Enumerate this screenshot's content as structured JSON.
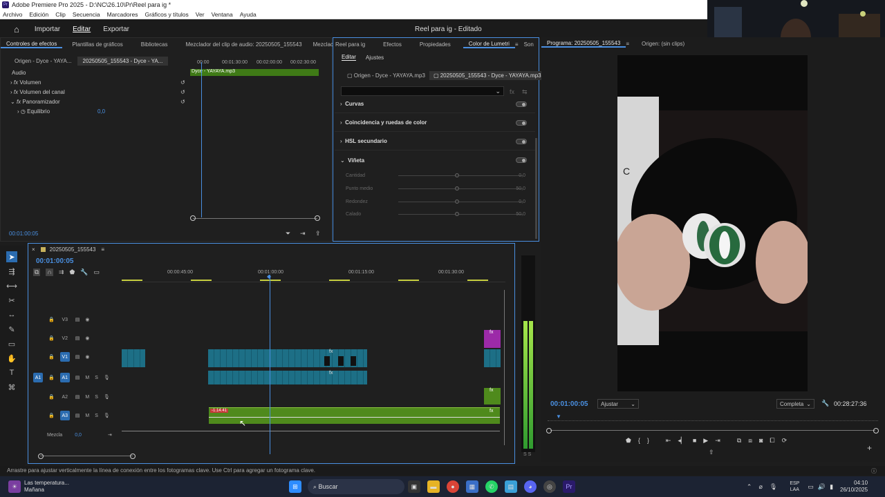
{
  "window": {
    "title": "Adobe Premiere Pro 2025 - D:\\NC\\26.10\\Pr\\Reel para ig *"
  },
  "menu": [
    "Archivo",
    "Edición",
    "Clip",
    "Secuencia",
    "Marcadores",
    "Gráficos y títulos",
    "Ver",
    "Ventana",
    "Ayuda"
  ],
  "nav": {
    "home_icon": "home-icon",
    "importar": "Importar",
    "editar": "Editar",
    "exportar": "Exportar",
    "project_title": "Reel para ig - Editado"
  },
  "effect_controls": {
    "tabs": [
      "Controles de efectos",
      "Plantillas de gráficos",
      "Bibliotecas",
      "Mezclador del clip de audio: 20250505_155543",
      "Mezclac"
    ],
    "source_tabs": [
      "Origen - Dyce - YAYA...",
      "20250505_155543 - Dyce - YA..."
    ],
    "section": "Audio",
    "rows": [
      "Volumen",
      "Volumen del canal",
      "Panoramizador",
      "Equilibrio"
    ],
    "equilibrio_value": "0,0",
    "ruler": [
      "00:00",
      "00:01:30:00",
      "00:02:00:00",
      "00:02:30:00"
    ],
    "clip_name": "Dyce - YAYAYA.mp3",
    "timecode": "00:01:00:05"
  },
  "lumetri": {
    "tabs": [
      "Reel para ig",
      "Efectos",
      "Propiedades",
      "Color de Lumetri",
      "Son"
    ],
    "subtabs": [
      "Editar",
      "Ajustes"
    ],
    "source_tabs": [
      "Origen - Dyce - YAYAYA.mp3",
      "20250505_155543 - Dyce - YAYAYA.mp3"
    ],
    "sections": [
      "Curvas",
      "Coincidencia y ruedas de color",
      "HSL secundario",
      "Viñeta"
    ],
    "vignette": [
      {
        "label": "Cantidad",
        "value": "0,0"
      },
      {
        "label": "Punto medio",
        "value": "50,0"
      },
      {
        "label": "Redondez",
        "value": "0,0"
      },
      {
        "label": "Calado",
        "value": "50,0"
      }
    ]
  },
  "program": {
    "tabs": [
      "Programa: 20250505_155543",
      "Origen: (sin clips)"
    ],
    "timecode": "00:01:00:05",
    "fit": "Ajustar",
    "quality": "Completa",
    "duration": "00:28:27:36",
    "preview_text": "C"
  },
  "timeline": {
    "sequence_name": "20250505_155543",
    "timecode": "00:01:00:05",
    "ruler": [
      "00:00:45:00",
      "00:01:00:00",
      "00:01:15:00",
      "00:01:30:00"
    ],
    "video_tracks": [
      "V3",
      "V2",
      "V1"
    ],
    "audio_tracks": [
      "A1",
      "A2",
      "A3"
    ],
    "mix_label": "Mezcla",
    "mix_value": "0,0",
    "clip_label": "-1.14.41",
    "fx": "fx",
    "audio_meter_label": "S S"
  },
  "status_bar": "Arrastre para ajustar verticalmente la línea de conexión entre los fotogramas clave. Use Ctrl para agregar un fotograma clave.",
  "taskbar": {
    "weather_title": "Las temperatura...",
    "weather_sub": "Mañana",
    "search": "Buscar",
    "lang": "ESP",
    "lang_sub": "LAA",
    "time": "04:10",
    "date": "26/10/2025"
  },
  "colors": {
    "accent": "#4a90e2",
    "green_clip": "#4f8a1c",
    "teal_clip": "#1d6f86"
  }
}
